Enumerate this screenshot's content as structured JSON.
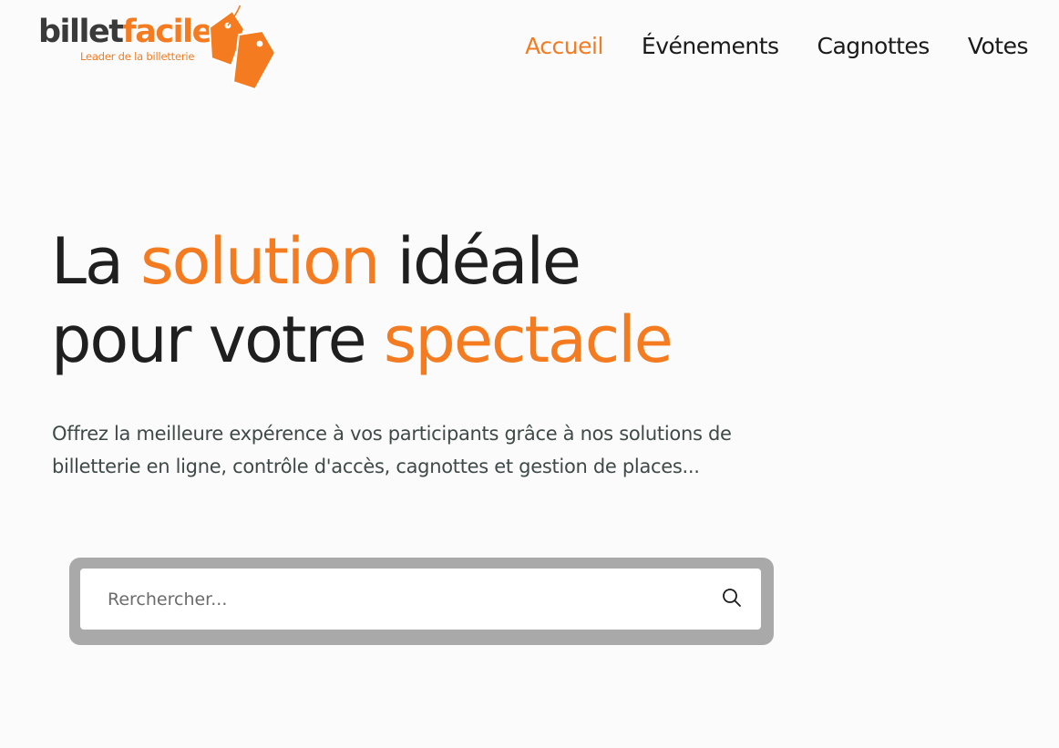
{
  "logo": {
    "brand_part1": "billet",
    "brand_part2": "facile",
    "tagline": "Leader de la billetterie"
  },
  "nav": {
    "items": [
      {
        "label": "Accueil",
        "active": true
      },
      {
        "label": "Événements",
        "active": false
      },
      {
        "label": "Cagnottes",
        "active": false
      },
      {
        "label": "Votes",
        "active": false
      }
    ]
  },
  "hero": {
    "title_line1_a": "La ",
    "title_line1_hl": "solution",
    "title_line1_b": " idéale",
    "title_line2_a": "pour votre ",
    "title_line2_hl": "spectacle",
    "description": "Offrez la meilleure expérence à vos participants grâce à nos solutions de billetterie en ligne, contrôle d'accès, cagnottes et gestion de places..."
  },
  "search": {
    "placeholder": "Rerchercher...",
    "icon": "search-icon"
  },
  "colors": {
    "accent": "#f47b20",
    "text": "#1f1f1f",
    "muted": "#3f4a48",
    "search_frame": "#a9a9a9"
  }
}
